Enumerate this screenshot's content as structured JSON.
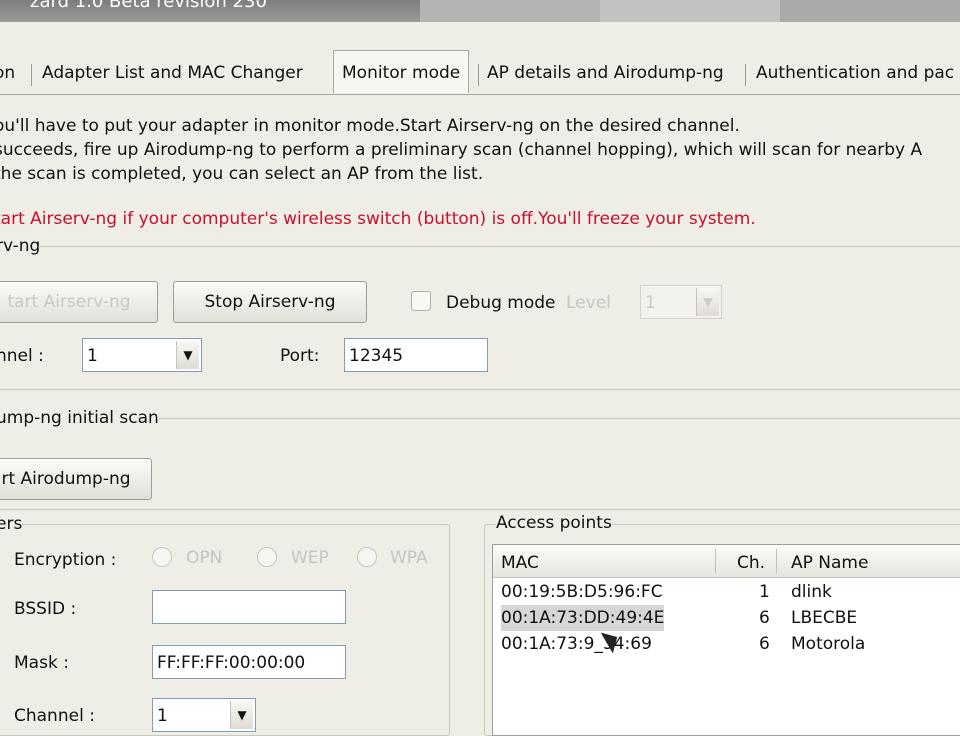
{
  "window": {
    "title": "zard 1.0 Beta revision 230"
  },
  "tabs": [
    {
      "label": "on"
    },
    {
      "label": "Adapter List and MAC Changer"
    },
    {
      "label": "Monitor mode"
    },
    {
      "label": "AP details and Airodump-ng"
    },
    {
      "label": "Authentication and pac"
    }
  ],
  "instructions": {
    "line1": "ou'll have to put your adapter in monitor mode.Start Airserv-ng on the desired channel.",
    "line2": "succeeds, fire up Airodump-ng to perform a preliminary scan (channel hopping), which will scan for nearby A",
    "line3": "the scan is completed, you can select  an AP from the list.",
    "warning": "tart Airserv-ng  if your computer's wireless switch (button)  is off.You'll freeze your system."
  },
  "airserv": {
    "group_label": "rv-ng",
    "start_label": "tart Airserv-ng",
    "stop_label": "Stop Airserv-ng",
    "debug_label": "Debug mode",
    "level_label": "Level",
    "level_value": "1",
    "channel_label": "nnel :",
    "channel_value": "1",
    "port_label": "Port:",
    "port_value": "12345"
  },
  "airodump": {
    "group_label": "ump-ng initial scan",
    "start_label": "rt Airodump-ng"
  },
  "filters": {
    "group_label": "ers",
    "encryption_label": "Encryption :",
    "enc_options": [
      "OPN",
      "WEP",
      "WPA"
    ],
    "bssid_label": "BSSID :",
    "bssid_value": "",
    "mask_label": "Mask :",
    "mask_value": "FF:FF:FF:00:00:00",
    "channel_label": "Channel :",
    "channel_value": "1"
  },
  "access_points": {
    "group_label": "Access points",
    "columns": [
      "MAC",
      "Ch.",
      "AP Name"
    ],
    "rows": [
      {
        "mac": "00:19:5B:D5:96:FC",
        "ch": "1",
        "name": "dlink"
      },
      {
        "mac": "00:1A:73:DD:49:4E",
        "ch": "6",
        "name": "LBECBE"
      },
      {
        "mac": "00:1A:73:9_34:69",
        "ch": "6",
        "name": "Motorola"
      }
    ]
  }
}
